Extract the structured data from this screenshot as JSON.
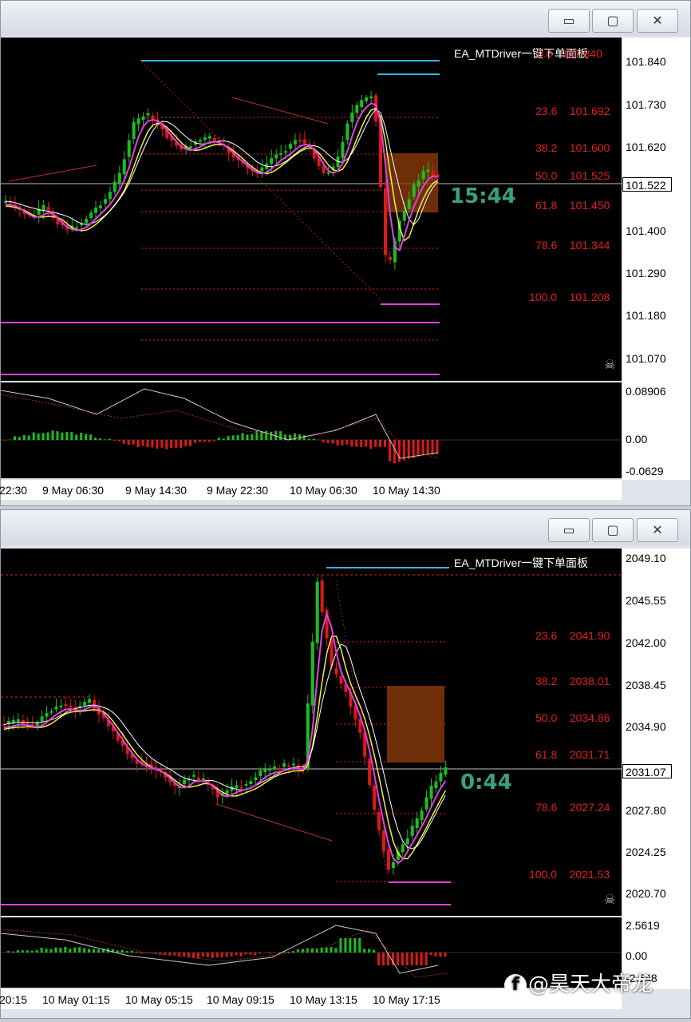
{
  "window_buttons": {
    "minimize": "▭",
    "restore": "▢",
    "close": "✕"
  },
  "top": {
    "ea_label": "EA_MTDriver一键下单面板",
    "timer": "15:44",
    "current_price": "101.522",
    "y_ticks": [
      "101.840",
      "101.730",
      "101.620",
      "101.400",
      "101.290",
      "101.180",
      "101.070"
    ],
    "indicator_ticks": [
      "0.08906",
      "0.00",
      "-0.0629"
    ],
    "x_ticks": [
      "22:30",
      "9 May 06:30",
      "9 May 14:30",
      "9 May 22:30",
      "10 May 06:30",
      "10 May 14:30"
    ],
    "fib_levels": [
      {
        "pct": "0.0",
        "price": "101.840"
      },
      {
        "pct": "23.6",
        "price": "101.692"
      },
      {
        "pct": "38.2",
        "price": "101.600"
      },
      {
        "pct": "50.0",
        "price": "101.525"
      },
      {
        "pct": "61.8",
        "price": "101.450"
      },
      {
        "pct": "78.6",
        "price": "101.344"
      },
      {
        "pct": "100.0",
        "price": "101.208"
      }
    ]
  },
  "bottom": {
    "ea_label": "EA_MTDriver一键下单面板",
    "timer": "0:44",
    "current_price": "2031.07",
    "y_ticks": [
      "2049.10",
      "2045.55",
      "2042.00",
      "2038.45",
      "2034.90",
      "2027.80",
      "2024.25",
      "2020.70"
    ],
    "indicator_ticks": [
      "2.5619",
      "0.00",
      "-2.548"
    ],
    "x_ticks": [
      "20:15",
      "10 May 01:15",
      "10 May 05:15",
      "10 May 09:15",
      "10 May 13:15",
      "10 May 17:15"
    ],
    "fib_levels": [
      {
        "pct": "23.6",
        "price": "2041.90"
      },
      {
        "pct": "38.2",
        "price": "2038.01"
      },
      {
        "pct": "50.0",
        "price": "2034.86"
      },
      {
        "pct": "61.8",
        "price": "2031.71"
      },
      {
        "pct": "78.6",
        "price": "2027.24"
      },
      {
        "pct": "100.0",
        "price": "2021.53"
      }
    ]
  },
  "watermark": {
    "logo": "f",
    "text": "@昊天大帝龙"
  },
  "colors": {
    "bull": "#18c020",
    "bear": "#e01818",
    "fib": "#e02020",
    "timer": "#3aa27a",
    "high_line": "#39b6e0",
    "low_line": "#e040e0",
    "ma_yellow": "#f0f040",
    "ma_pink": "#e040e0"
  }
}
